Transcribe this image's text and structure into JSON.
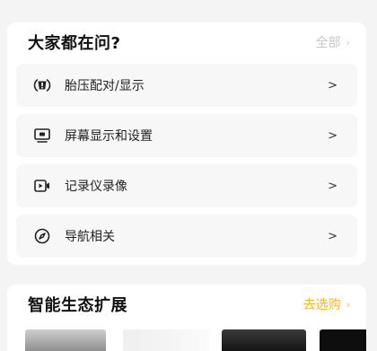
{
  "faq": {
    "title": "大家都在问?",
    "more_label": "全部",
    "items": [
      {
        "label": "胎压配对/显示",
        "icon": "tire-pressure-icon"
      },
      {
        "label": "屏幕显示和设置",
        "icon": "screen-icon"
      },
      {
        "label": "记录仪录像",
        "icon": "dashcam-icon"
      },
      {
        "label": "导航相关",
        "icon": "compass-icon"
      }
    ]
  },
  "ecosystem": {
    "title": "智能生态扩展",
    "more_label": "去选购",
    "products": [
      "product-1",
      "product-2",
      "product-3",
      "product-4"
    ]
  },
  "colors": {
    "page_bg": "#f4f4f5",
    "card_bg": "#ffffff",
    "item_bg": "#f7f7f8",
    "accent": "#f5b51e",
    "muted": "#c6c6c6"
  }
}
